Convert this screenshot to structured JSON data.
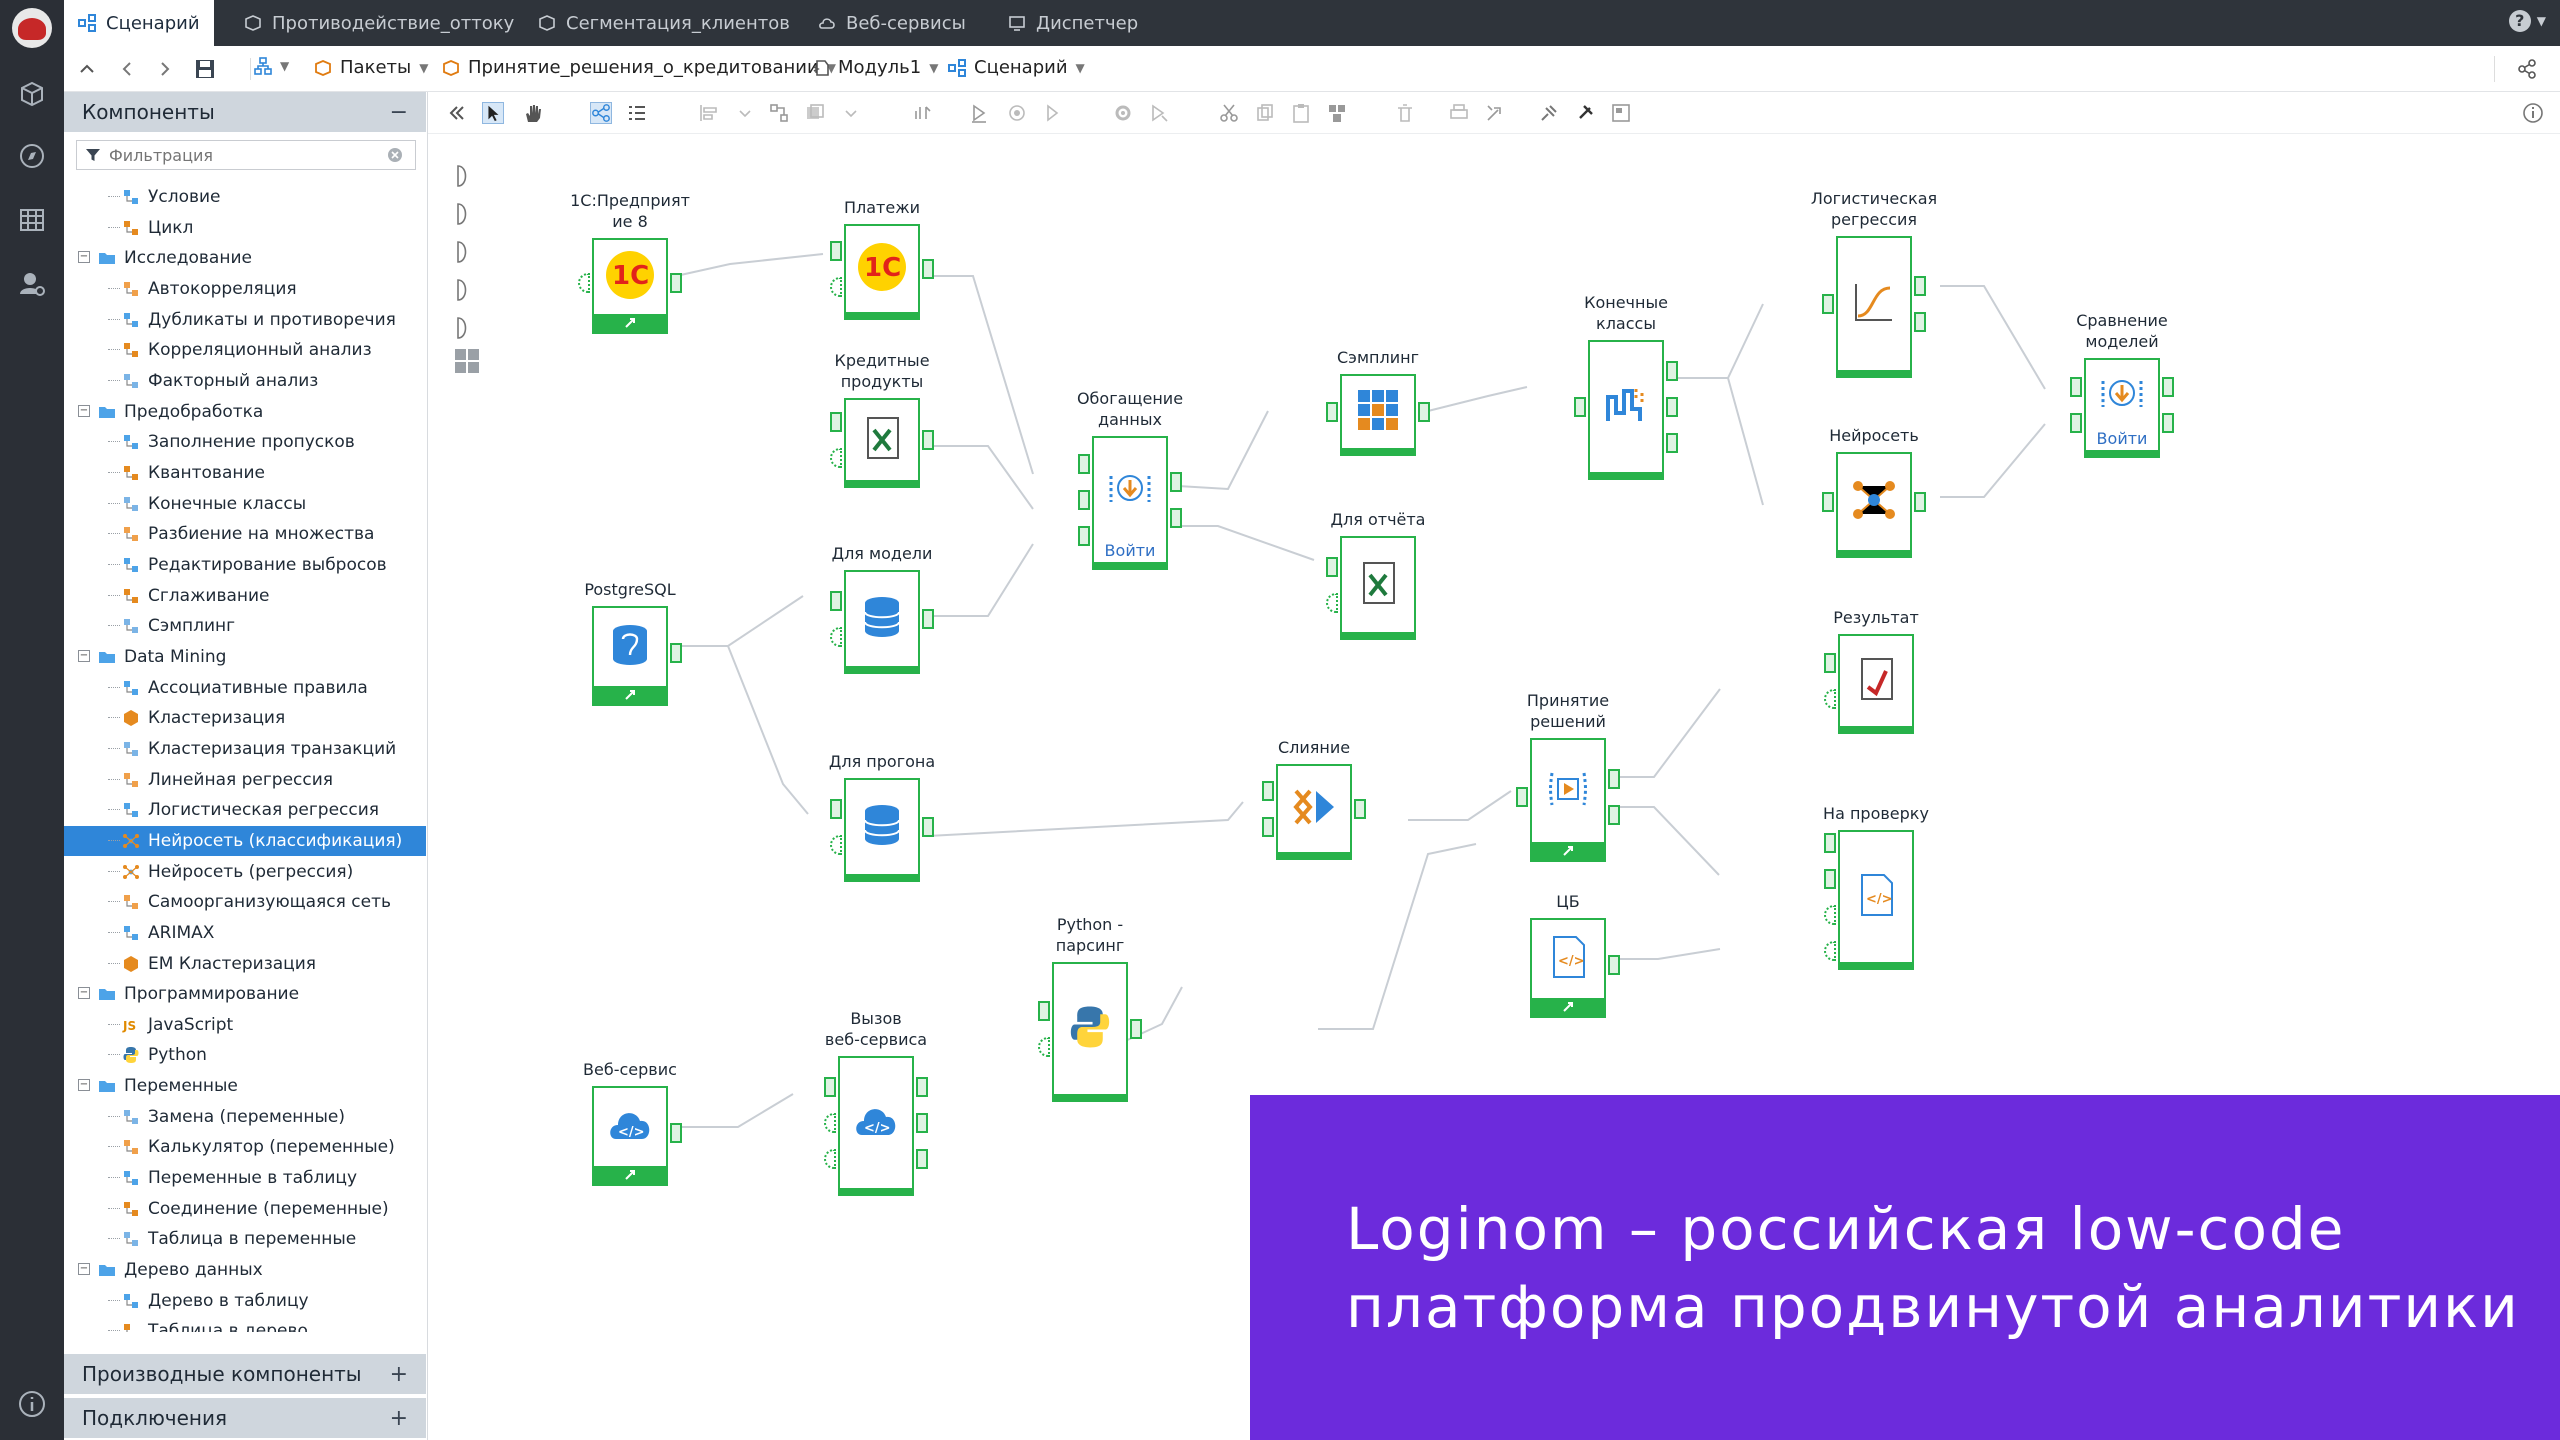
{
  "tabs": [
    {
      "label": "Сценарий",
      "active": true
    },
    {
      "label": "Противодействие_оттоку"
    },
    {
      "label": "Сегментация_клиентов"
    },
    {
      "label": "Веб-сервисы"
    },
    {
      "label": "Диспетчер"
    }
  ],
  "help_label": "?",
  "breadcrumb": [
    "Пакеты",
    "Принятие_решения_о_кредитовании",
    "Модуль1",
    "Сценарий"
  ],
  "panel": {
    "components_title": "Компоненты",
    "filter_placeholder": "Фильтрация",
    "derived_title": "Производные компоненты",
    "connections_title": "Подключения",
    "collapse": "−",
    "add": "+"
  },
  "tree": [
    {
      "label": "Условие",
      "level": 2,
      "icon": "condition-icon"
    },
    {
      "label": "Цикл",
      "level": 2,
      "icon": "loop-icon"
    },
    {
      "label": "Исследование",
      "level": 1,
      "icon": "folder-icon"
    },
    {
      "label": "Автокорреляция",
      "level": 2,
      "icon": "autocorrelation-icon"
    },
    {
      "label": "Дубликаты и противоречия",
      "level": 2,
      "icon": "duplicates-icon"
    },
    {
      "label": "Корреляционный анализ",
      "level": 2,
      "icon": "correlation-icon"
    },
    {
      "label": "Факторный анализ",
      "level": 2,
      "icon": "factor-icon"
    },
    {
      "label": "Предобработка",
      "level": 1,
      "icon": "folder-icon"
    },
    {
      "label": "Заполнение пропусков",
      "level": 2,
      "icon": "fill-gaps-icon"
    },
    {
      "label": "Квантование",
      "level": 2,
      "icon": "quantization-icon"
    },
    {
      "label": "Конечные классы",
      "level": 2,
      "icon": "final-classes-icon"
    },
    {
      "label": "Разбиение на множества",
      "level": 2,
      "icon": "split-icon"
    },
    {
      "label": "Редактирование выбросов",
      "level": 2,
      "icon": "outliers-icon"
    },
    {
      "label": "Сглаживание",
      "level": 2,
      "icon": "smoothing-icon"
    },
    {
      "label": "Сэмплинг",
      "level": 2,
      "icon": "sampling-icon"
    },
    {
      "label": "Data Mining",
      "level": 1,
      "icon": "folder-icon"
    },
    {
      "label": "Ассоциативные правила",
      "level": 2,
      "icon": "association-icon"
    },
    {
      "label": "Кластеризация",
      "level": 2,
      "icon": "cluster-icon"
    },
    {
      "label": "Кластеризация транзакций",
      "level": 2,
      "icon": "transaction-cluster-icon"
    },
    {
      "label": "Линейная регрессия",
      "level": 2,
      "icon": "linear-regression-icon"
    },
    {
      "label": "Логистическая регрессия",
      "level": 2,
      "icon": "logistic-regression-icon"
    },
    {
      "label": "Нейросеть (классификация)",
      "level": 2,
      "icon": "neural-net-icon",
      "selected": true
    },
    {
      "label": "Нейросеть (регрессия)",
      "level": 2,
      "icon": "neural-net-icon"
    },
    {
      "label": "Самоорганизующаяся сеть",
      "level": 2,
      "icon": "som-icon"
    },
    {
      "label": "ARIMAX",
      "level": 2,
      "icon": "arimax-icon"
    },
    {
      "label": "EM Кластеризация",
      "level": 2,
      "icon": "em-cluster-icon"
    },
    {
      "label": "Программирование",
      "level": 1,
      "icon": "folder-icon"
    },
    {
      "label": "JavaScript",
      "level": 2,
      "icon": "js-icon"
    },
    {
      "label": "Python",
      "level": 2,
      "icon": "python-icon"
    },
    {
      "label": "Переменные",
      "level": 1,
      "icon": "folder-icon"
    },
    {
      "label": "Замена (переменные)",
      "level": 2,
      "icon": "replace-vars-icon"
    },
    {
      "label": "Калькулятор (переменные)",
      "level": 2,
      "icon": "calculator-icon"
    },
    {
      "label": "Переменные в таблицу",
      "level": 2,
      "icon": "vars-to-table-icon"
    },
    {
      "label": "Соединение (переменные)",
      "level": 2,
      "icon": "join-vars-icon"
    },
    {
      "label": "Таблица в переменные",
      "level": 2,
      "icon": "table-to-vars-icon"
    },
    {
      "label": "Дерево данных",
      "level": 1,
      "icon": "folder-icon"
    },
    {
      "label": "Дерево в таблицу",
      "level": 2,
      "icon": "tree-to-table-icon"
    },
    {
      "label": "Таблица в дерево",
      "level": 2,
      "icon": "table-to-tree-icon"
    }
  ],
  "nodes": [
    {
      "id": "n1c_src",
      "label": "1С:Предприят\nие 8",
      "icon": "1c-icon"
    },
    {
      "id": "payments",
      "label": "Платежи",
      "icon": "1c-icon"
    },
    {
      "id": "credit",
      "label": "Кредитные\nпродукты",
      "icon": "excel-icon"
    },
    {
      "id": "formodel",
      "label": "Для модели",
      "icon": "database-icon"
    },
    {
      "id": "pg",
      "label": "PostgreSQL",
      "icon": "postgresql-icon"
    },
    {
      "id": "forrun",
      "label": "Для прогона",
      "icon": "database-icon"
    },
    {
      "id": "enrich",
      "label": "Обогащение\nданных",
      "icon": "supernode-icon",
      "enter": "Войти"
    },
    {
      "id": "sampling",
      "label": "Сэмплинг",
      "icon": "sampling-icon"
    },
    {
      "id": "report",
      "label": "Для отчёта",
      "icon": "excel-icon"
    },
    {
      "id": "final",
      "label": "Конечные\nклассы",
      "icon": "final-classes-icon"
    },
    {
      "id": "logreg",
      "label": "Логистическая\nрегрессия",
      "icon": "logistic-curve-icon"
    },
    {
      "id": "nnet",
      "label": "Нейросеть",
      "icon": "neural-net-icon"
    },
    {
      "id": "compare",
      "label": "Сравнение\nмоделей",
      "icon": "supernode-icon",
      "enter": "Войти"
    },
    {
      "id": "merge",
      "label": "Слияние",
      "icon": "merge-icon"
    },
    {
      "id": "decision",
      "label": "Принятие\nрешений",
      "icon": "decision-icon"
    },
    {
      "id": "result",
      "label": "Результат",
      "icon": "report-icon"
    },
    {
      "id": "check",
      "label": "На проверку",
      "icon": "xml-icon"
    },
    {
      "id": "cb",
      "label": "ЦБ",
      "icon": "xml-icon"
    },
    {
      "id": "python",
      "label": "Python -\nпарсинг",
      "icon": "python-icon"
    },
    {
      "id": "wscall",
      "label": "Вызов\nвеб-сервиса",
      "icon": "webservice-icon"
    },
    {
      "id": "ws",
      "label": "Веб-сервис",
      "icon": "webservice-icon"
    }
  ],
  "promo": {
    "line1": "Loginom – российская low-code",
    "line2": "платформа продвинутой аналитики"
  },
  "colors": {
    "accent": "#27b24a",
    "selection": "#2f86d9",
    "promo": "#6c2bdc",
    "dark": "#2f343b"
  }
}
